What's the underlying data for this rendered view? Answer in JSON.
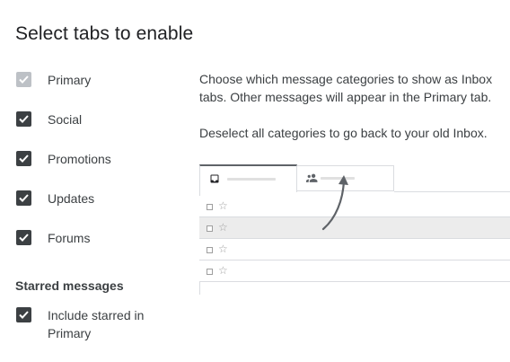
{
  "title": "Select tabs to enable",
  "categories": [
    {
      "label": "Primary",
      "checked": true,
      "disabled": true
    },
    {
      "label": "Social",
      "checked": true,
      "disabled": false
    },
    {
      "label": "Promotions",
      "checked": true,
      "disabled": false
    },
    {
      "label": "Updates",
      "checked": true,
      "disabled": false
    },
    {
      "label": "Forums",
      "checked": true,
      "disabled": false
    }
  ],
  "starred": {
    "heading": "Starred messages",
    "option_line1": "Include starred in",
    "option_line2": "Primary",
    "checked": true
  },
  "description": {
    "line1": "Choose which message categories to show as Inbox",
    "line2": "tabs. Other messages will appear in the Primary tab.",
    "line3": "Deselect all categories to go back to your old Inbox."
  },
  "illustration": {
    "tabs": [
      {
        "icon": "inbox-icon"
      },
      {
        "icon": "people-icon"
      }
    ],
    "row_icons": [
      "checkbox-icon",
      "star-icon"
    ],
    "star_glyph": "☆"
  },
  "colors": {
    "checkbox": "#3c4043",
    "checkbox_disabled": "#bdc1c6",
    "text": "#3c4043",
    "border": "#dadce0",
    "row_highlight": "#ececec"
  }
}
